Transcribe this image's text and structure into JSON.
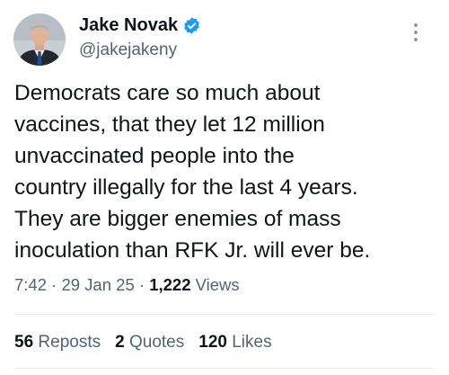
{
  "author": {
    "display_name": "Jake Novak",
    "handle": "@jakejakeny",
    "verified": true,
    "verified_color": "#1d9bf0"
  },
  "post": {
    "lines": [
      "Democrats care so much about",
      "vaccines, that they let 12 million",
      "unvaccinated people into the",
      "country illegally for the last 4 years.",
      "They are bigger enemies of mass",
      "inoculation than RFK Jr. will ever be."
    ]
  },
  "meta": {
    "time": "7:42",
    "sep1": " · ",
    "date": "29 Jan 25",
    "sep2": " · ",
    "views_count": "1,222",
    "views_label": " Views"
  },
  "stats": {
    "reposts_count": "56",
    "reposts_label": "Reposts",
    "quotes_count": "2",
    "quotes_label": "Quotes",
    "likes_count": "120",
    "likes_label": "Likes"
  },
  "icons": {
    "verified": "verified-badge-icon",
    "more": "more-options-icon"
  },
  "colors": {
    "text_primary": "#0f1419",
    "text_secondary": "#536471",
    "divider": "#e7e9ea"
  }
}
